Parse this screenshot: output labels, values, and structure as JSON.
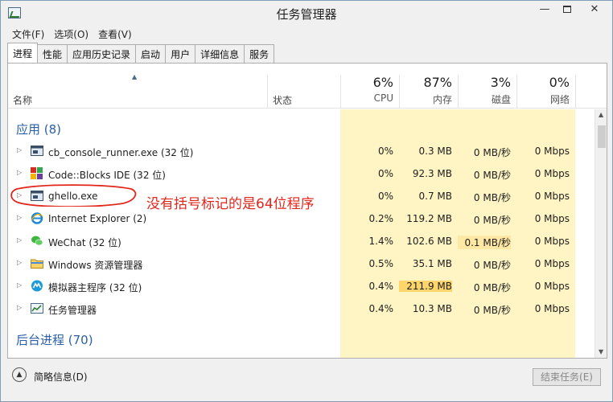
{
  "window": {
    "title": "任务管理器",
    "minimize_glyph": "—",
    "close_glyph": "✕"
  },
  "menu": [
    "文件(F)",
    "选项(O)",
    "查看(V)"
  ],
  "tabs": [
    "进程",
    "性能",
    "应用历史记录",
    "启动",
    "用户",
    "详细信息",
    "服务"
  ],
  "active_tab": "进程",
  "header": {
    "name": "名称",
    "status": "状态",
    "cpu": {
      "pct": "6%",
      "label": "CPU"
    },
    "memory": {
      "pct": "87%",
      "label": "内存"
    },
    "disk": {
      "pct": "3%",
      "label": "磁盘"
    },
    "network": {
      "pct": "0%",
      "label": "网络"
    },
    "sort_glyph": "▲"
  },
  "sections": {
    "apps": "应用 (8)",
    "background": "后台进程 (70)"
  },
  "processes": [
    {
      "name": "cb_console_runner.exe (32 位)",
      "icon": "console-window-icon",
      "cpu": "0%",
      "memory": "0.3 MB",
      "disk": "0 MB/秒",
      "network": "0 Mbps"
    },
    {
      "name": "Code::Blocks IDE (32 位)",
      "icon": "codeblocks-icon",
      "cpu": "0%",
      "memory": "92.3 MB",
      "disk": "0 MB/秒",
      "network": "0 Mbps"
    },
    {
      "name": "ghello.exe",
      "icon": "console-window-icon",
      "cpu": "0%",
      "memory": "0.7 MB",
      "disk": "0 MB/秒",
      "network": "0 Mbps"
    },
    {
      "name": "Internet Explorer (2)",
      "icon": "internet-explorer-icon",
      "cpu": "0.2%",
      "memory": "119.2 MB",
      "disk": "0 MB/秒",
      "network": "0 Mbps"
    },
    {
      "name": "WeChat (32 位)",
      "icon": "wechat-icon",
      "cpu": "1.4%",
      "memory": "102.6 MB",
      "disk": "0.1 MB/秒",
      "network": "0 Mbps"
    },
    {
      "name": "Windows 资源管理器",
      "icon": "folder-icon",
      "cpu": "0.5%",
      "memory": "35.1 MB",
      "disk": "0 MB/秒",
      "network": "0 Mbps"
    },
    {
      "name": "模拟器主程序 (32 位)",
      "icon": "emulator-icon",
      "cpu": "0.4%",
      "memory": "211.9 MB",
      "disk": "0 MB/秒",
      "network": "0 Mbps"
    },
    {
      "name": "任务管理器",
      "icon": "task-manager-icon",
      "cpu": "0.4%",
      "memory": "10.3 MB",
      "disk": "0 MB/秒",
      "network": "0 Mbps"
    }
  ],
  "annotation": "没有括号标记的是64位程序",
  "footer": {
    "collapse_label": "简略信息(D)",
    "end_task": "结束任务(E)"
  },
  "colors": {
    "section_title": "#2a5fa8",
    "heat_light": "#fff4c4",
    "heat_medium": "#ffe8a3",
    "heat_strong": "#fdd56a",
    "annotation_red": "#e2261c"
  }
}
